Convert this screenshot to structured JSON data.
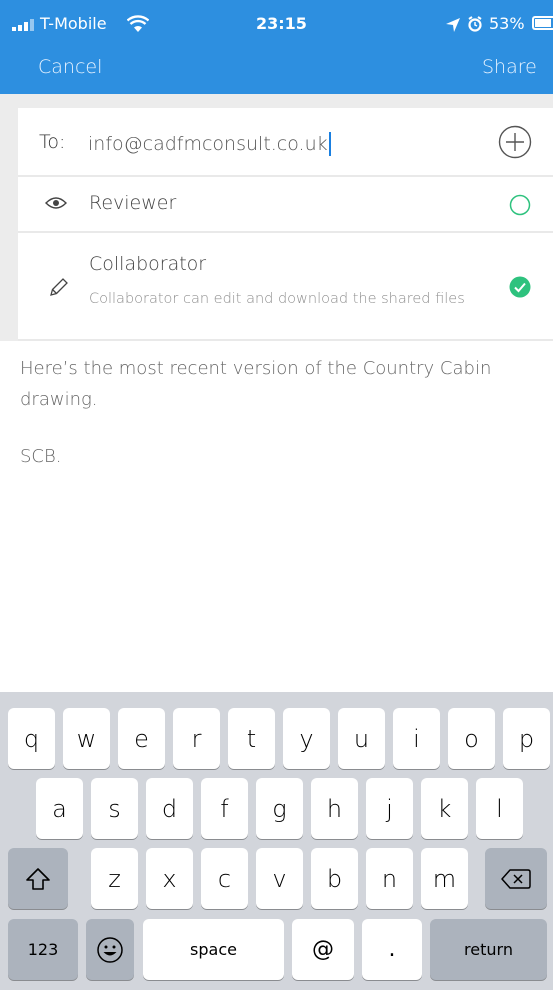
{
  "status_bar": {
    "carrier": "T-Mobile",
    "time": "23:15",
    "battery": "53%"
  },
  "nav": {
    "cancel": "Cancel",
    "share": "Share"
  },
  "to_row": {
    "label": "To:",
    "value": "info@cadfmconsult.co.uk"
  },
  "roles": [
    {
      "label": "Reviewer",
      "icon": "eye-icon",
      "selected": false,
      "description": ""
    },
    {
      "label": "Collaborator",
      "icon": "pencil-icon",
      "selected": true,
      "description": "Collaborator can edit and download the shared files"
    }
  ],
  "message": {
    "line1": "Here’s the most recent version of the Country Cabin",
    "line2": "drawing.",
    "line3": "SCB."
  },
  "keyboard": {
    "row1": [
      "q",
      "w",
      "e",
      "r",
      "t",
      "y",
      "u",
      "i",
      "o",
      "p"
    ],
    "row2": [
      "a",
      "s",
      "d",
      "f",
      "g",
      "h",
      "j",
      "k",
      "l"
    ],
    "row3": [
      "z",
      "x",
      "c",
      "v",
      "b",
      "n",
      "m"
    ],
    "num": "123",
    "space": "space",
    "at": "@",
    "dot": ".",
    "return": "return"
  },
  "colors": {
    "header": "#2d8fe0",
    "accent_green": "#2ec27e",
    "cursor": "#1a7fe0"
  }
}
